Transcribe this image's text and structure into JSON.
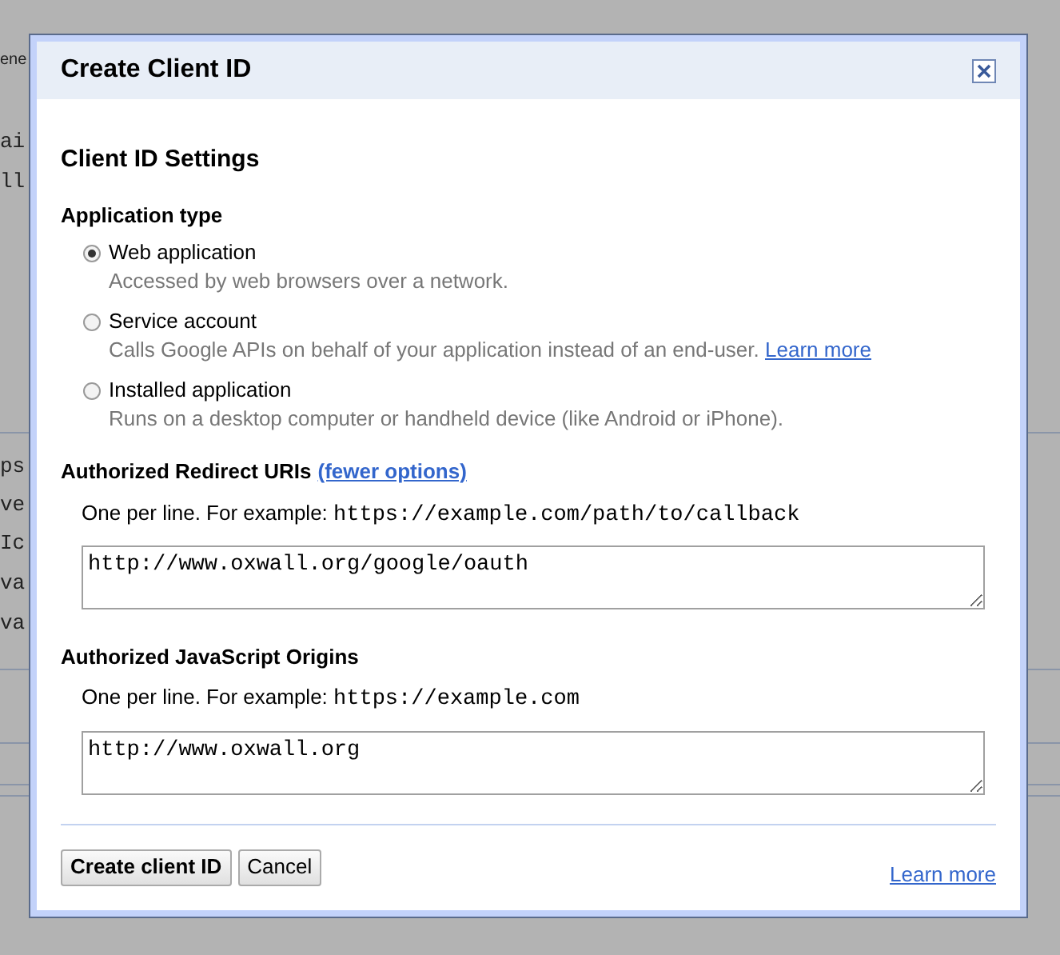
{
  "background_fragments": [
    {
      "kind": "sans",
      "text": "ene"
    },
    {
      "kind": "mono",
      "text": "ai"
    },
    {
      "kind": "mono",
      "text": "ll"
    },
    {
      "kind": "mono",
      "text": "ps"
    },
    {
      "kind": "mono",
      "text": "ve"
    },
    {
      "kind": "mono",
      "text": "Ic"
    },
    {
      "kind": "mono",
      "text": "va"
    },
    {
      "kind": "mono",
      "text": "va"
    }
  ],
  "dialog": {
    "title": "Create Client ID",
    "section_title": "Client ID Settings",
    "application_type": {
      "label": "Application type",
      "options": [
        {
          "label": "Web application",
          "description": "Accessed by web browsers over a network.",
          "selected": true
        },
        {
          "label": "Service account",
          "description": "Calls Google APIs on behalf of your application instead of an end-user.",
          "link": "Learn more",
          "selected": false
        },
        {
          "label": "Installed application",
          "description": "Runs on a desktop computer or handheld device (like Android or iPhone).",
          "selected": false
        }
      ]
    },
    "redirect_uris": {
      "label": "Authorized Redirect URIs",
      "link": "(fewer options)",
      "hint": "One per line. For example:",
      "example": "https://example.com/path/to/callback",
      "value": "http://www.oxwall.org/google/oauth"
    },
    "javascript_origins": {
      "label": "Authorized JavaScript Origins",
      "hint": "One per line. For example:",
      "example": "https://example.com",
      "value": "http://www.oxwall.org"
    },
    "buttons": [
      {
        "label": "Create client ID",
        "kind": "primary"
      },
      {
        "label": "Cancel",
        "kind": "secondary"
      }
    ],
    "footer_link": "Learn more"
  }
}
